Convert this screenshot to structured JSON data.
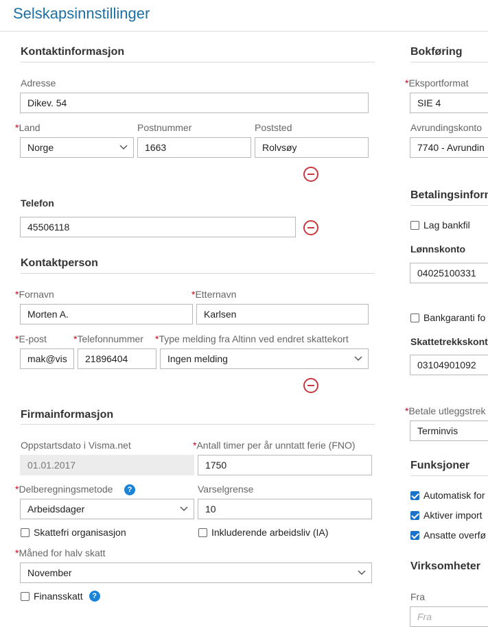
{
  "page": {
    "title": "Selskapsinnstillinger"
  },
  "contact": {
    "heading": "Kontaktinformasjon",
    "address_label": "Adresse",
    "address_value": "Dikev. 54",
    "country_label": "Land",
    "country_value": "Norge",
    "postcode_label": "Postnummer",
    "postcode_value": "1663",
    "city_label": "Poststed",
    "city_value": "Rolvsøy",
    "phone_label": "Telefon",
    "phone_value": "45506118"
  },
  "contact_person": {
    "heading": "Kontaktperson",
    "firstname_label": "Fornavn",
    "firstname_value": "Morten A.",
    "lastname_label": "Etternavn",
    "lastname_value": "Karlsen",
    "email_label": "E-post",
    "email_value": "mak@vis",
    "phone_label": "Telefonnummer",
    "phone_value": "21896404",
    "altinn_label": "Type melding fra Altinn ved endret skattekort",
    "altinn_value": "Ingen melding"
  },
  "company": {
    "heading": "Firmainformasjon",
    "startdate_label": "Oppstartsdato i Visma.net",
    "startdate_value": "01.01.2017",
    "hours_label": "Antall timer per år unntatt ferie (FNO)",
    "hours_value": "1750",
    "partial_label": "Delberegningsmetode",
    "partial_value": "Arbeidsdager",
    "warning_label": "Varselgrense",
    "warning_value": "10",
    "taxfree_label": "Skattefri organisasjon",
    "inclusive_label": "Inkluderende arbeidsliv (IA)",
    "halftax_label": "Måned for halv skatt",
    "halftax_value": "November",
    "financetax_label": "Finansskatt"
  },
  "accounting": {
    "heading": "Bokføring",
    "export_label": "Eksportformat",
    "export_value": "SIE 4",
    "rounding_label": "Avrundingskonto",
    "rounding_value": "7740 - Avrundin"
  },
  "payment": {
    "heading": "Betalingsinforn",
    "bankfile_label": "Lag bankfil",
    "salary_account_label": "Lønnskonto",
    "salary_account_value": "04025100331",
    "guarantee_label": "Bankgaranti fo",
    "tax_account_label": "Skattetrekkskont",
    "tax_account_value": "03104901092",
    "payout_label": "Betale utleggstrek",
    "payout_value": "Terminvis"
  },
  "functions": {
    "heading": "Funksjoner",
    "items": [
      {
        "label": "Automatisk for",
        "checked": true
      },
      {
        "label": "Aktiver import",
        "checked": true
      },
      {
        "label": "Ansatte overfø",
        "checked": true
      }
    ]
  },
  "businesses": {
    "heading": "Virksomheter",
    "from_label": "Fra",
    "from_placeholder": "Fra"
  },
  "icons": {
    "remove": "minus-circle-icon",
    "dropdown": "chevron-down-icon",
    "help": "help-icon"
  },
  "colors": {
    "title": "#1c6fa3",
    "required": "#d0021b",
    "remove": "#c8373d",
    "checkbox": "#1a73c9",
    "help": "#1a84d9"
  }
}
